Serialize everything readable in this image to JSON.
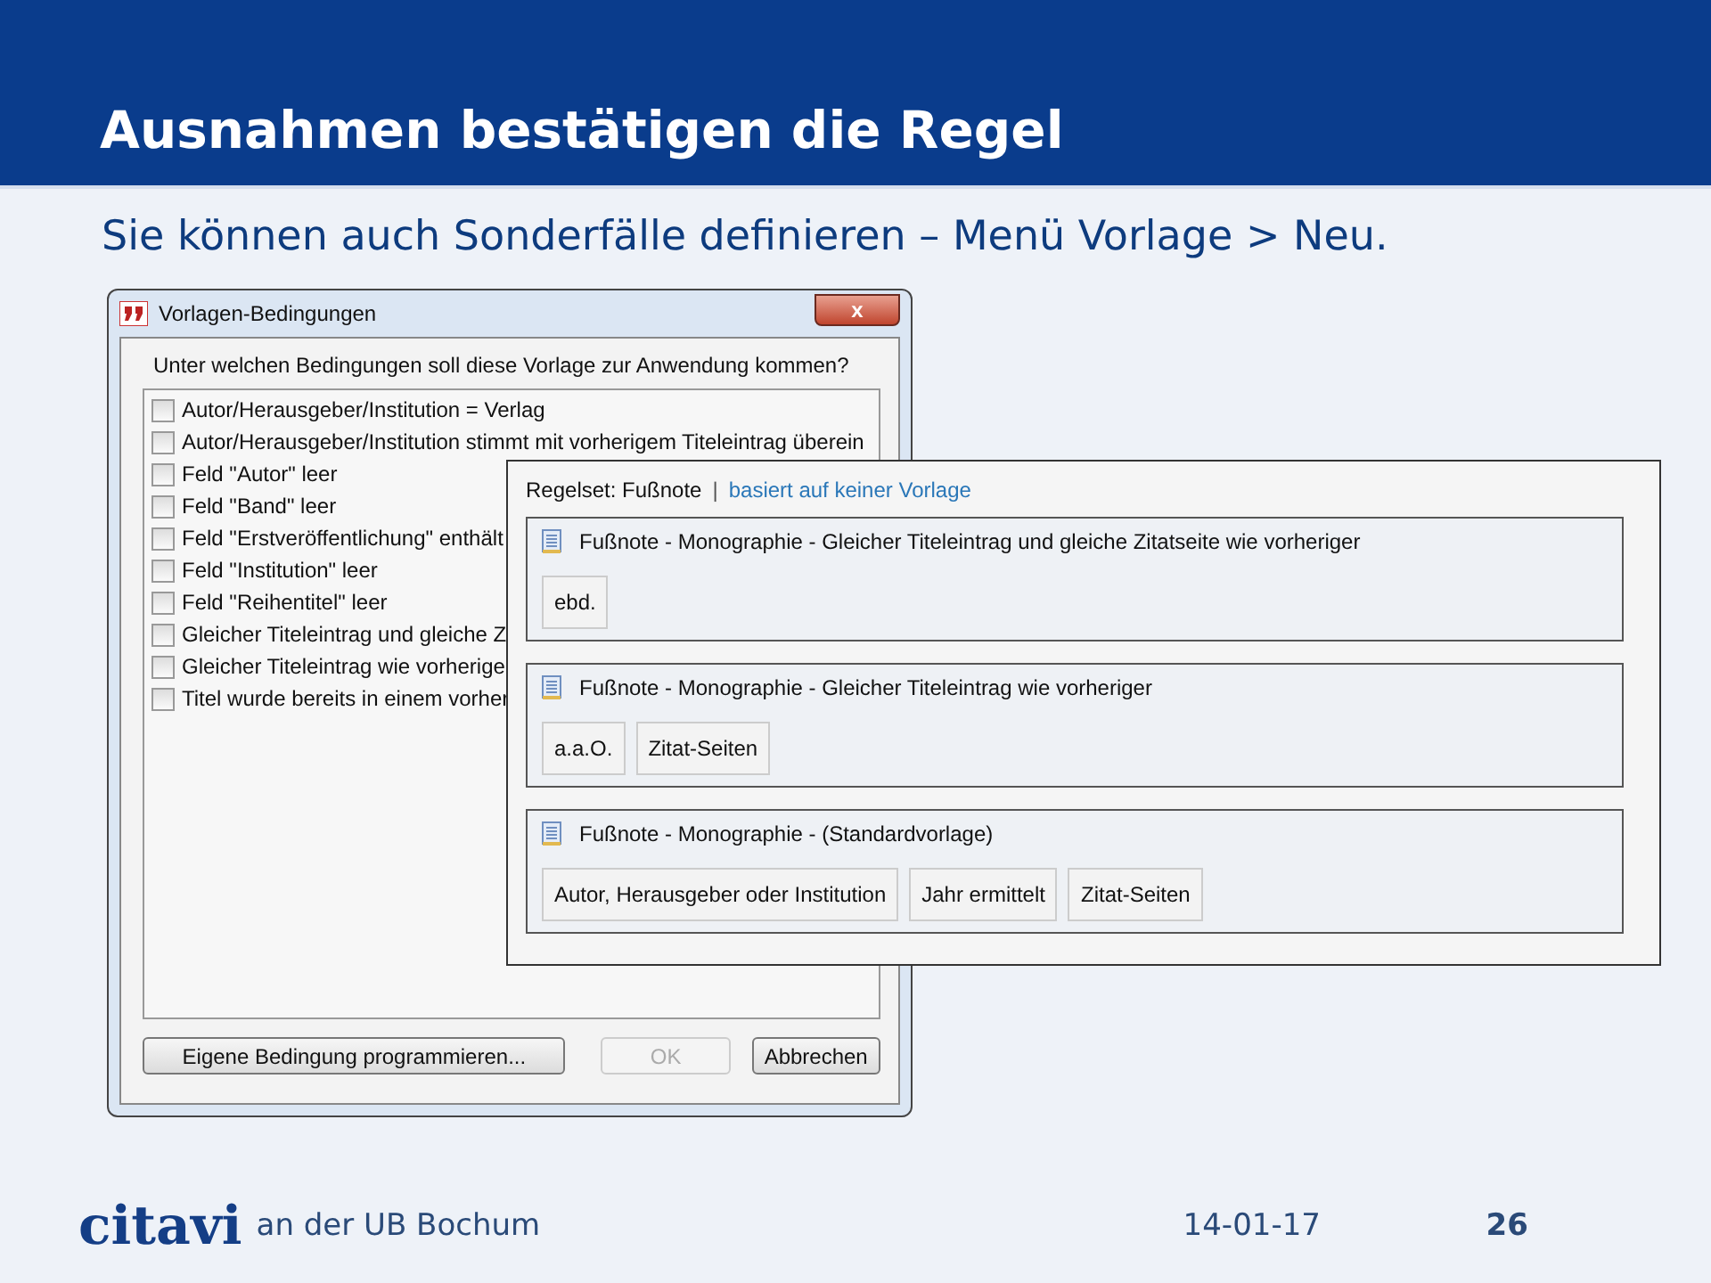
{
  "slide": {
    "title": "Ausnahmen bestätigen die Regel",
    "subtitle": "Sie können auch Sonderfälle definieren – Menü Vorlage > Neu."
  },
  "dialog": {
    "title": "Vorlagen-Bedingungen",
    "close": "x",
    "question": "Unter welchen Bedingungen soll diese Vorlage zur Anwendung kommen?",
    "conditions": [
      {
        "label": "Autor/Herausgeber/Institution = Verlag",
        "checked": false
      },
      {
        "label": "Autor/Herausgeber/Institution stimmt mit vorherigem Titeleintrag überein",
        "checked": false
      },
      {
        "label": "Feld \"Autor\" leer",
        "checked": false
      },
      {
        "label": "Feld \"Band\" leer",
        "checked": false
      },
      {
        "label": "Feld \"Erstveröffentlichung\" enthält",
        "checked": false
      },
      {
        "label": "Feld \"Institution\" leer",
        "checked": false
      },
      {
        "label": "Feld \"Reihentitel\" leer",
        "checked": false
      },
      {
        "label": "Gleicher Titeleintrag und gleiche Z",
        "checked": false
      },
      {
        "label": "Gleicher Titeleintrag wie vorherige",
        "checked": false
      },
      {
        "label": "Titel wurde bereits in einem vorher",
        "checked": false
      }
    ],
    "buttons": [
      {
        "label": "Eigene Bedingung programmieren...",
        "disabled": false
      },
      {
        "label": "OK",
        "disabled": true
      },
      {
        "label": "Abbrechen",
        "disabled": false
      }
    ]
  },
  "ruleset": {
    "label": "Regelset: Fußnote",
    "separator": "|",
    "link": "basiert auf keiner Vorlage",
    "templates": [
      {
        "title": "Fußnote - Monographie -  Gleicher Titeleintrag und gleiche Zitatseite wie vorheriger",
        "components": [
          "ebd."
        ]
      },
      {
        "title": "Fußnote - Monographie -  Gleicher Titeleintrag wie vorheriger",
        "components": [
          "a.a.O.",
          "Zitat-Seiten"
        ]
      },
      {
        "title": "Fußnote - Monographie - (Standardvorlage)",
        "components": [
          "Autor, Herausgeber oder Institution",
          "Jahr ermittelt",
          "Zitat-Seiten"
        ]
      }
    ]
  },
  "footer": {
    "logo": "citavi",
    "organization": "an der UB Bochum",
    "date": "14-01-17",
    "page": "26"
  }
}
